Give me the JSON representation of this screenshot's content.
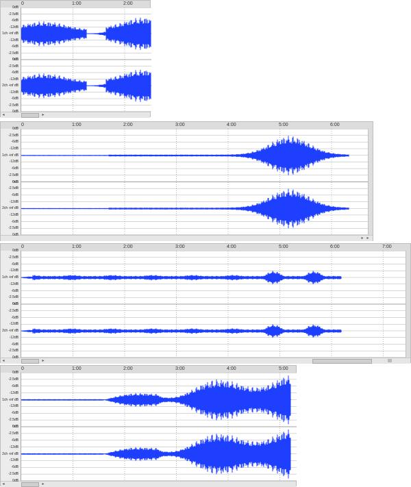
{
  "panels": [
    {
      "ticks": [
        "0",
        "1:00",
        "2:00"
      ],
      "channels": [
        {
          "name_label": "1ch -inf dB"
        },
        {
          "name_label": "2ch -inf dB"
        }
      ]
    },
    {
      "ticks": [
        "0",
        "1:00",
        "2:00",
        "3:00",
        "4:00",
        "5:00",
        "6:00"
      ],
      "channels": [
        {
          "name_label": "1ch -inf dB"
        },
        {
          "name_label": "2ch -inf dB"
        }
      ]
    },
    {
      "ticks": [
        "0",
        "1:00",
        "2:00",
        "3:00",
        "4:00",
        "5:00",
        "6:00",
        "7:00"
      ],
      "channels": [
        {
          "name_label": "1ch -inf dB"
        },
        {
          "name_label": "2ch -inf dB"
        }
      ]
    },
    {
      "ticks": [
        "0",
        "1:00",
        "2:00",
        "3:00",
        "4:00",
        "5:00"
      ],
      "channels": [
        {
          "name_label": "1ch -inf dB"
        },
        {
          "name_label": "2ch -inf dB"
        }
      ]
    }
  ],
  "db_scale_top": [
    "0dB",
    "-2.5dB",
    "-6dB",
    "-12dB"
  ],
  "db_scale_bottom": [
    "-12dB",
    "-6dB",
    "-2.5dB",
    "0dB"
  ],
  "waveform_color": "#1f3fff",
  "ruler_bg_color": "#dcdcdc"
}
